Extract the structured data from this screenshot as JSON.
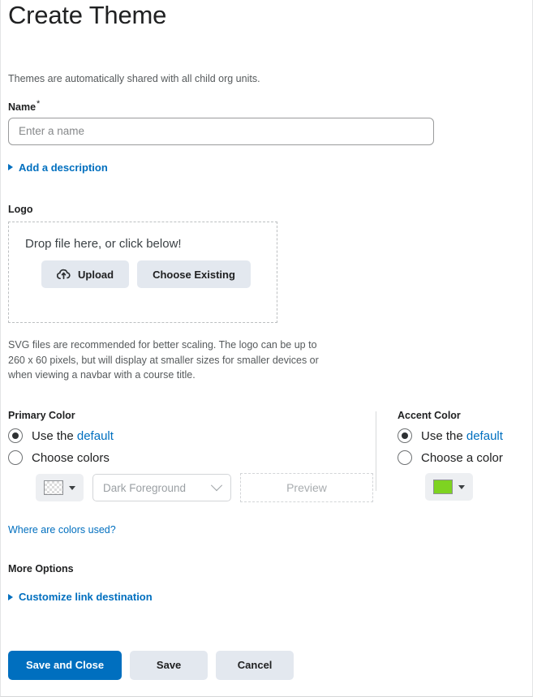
{
  "page": {
    "title": "Create Theme",
    "intro": "Themes are automatically shared with all child org units."
  },
  "name_field": {
    "label": "Name",
    "required_marker": "*",
    "value": "",
    "placeholder": "Enter a name"
  },
  "description": {
    "toggle_label": "Add a description",
    "icon": "triangle-right-icon"
  },
  "logo": {
    "label": "Logo",
    "dropzone_text": "Drop file here, or click below!",
    "upload_label": "Upload",
    "upload_icon": "cloud-upload-icon",
    "choose_existing_label": "Choose Existing",
    "helper_text": "SVG files are recommended for better scaling. The logo can be up to 260 x 60 pixels, but will display at smaller sizes for smaller devices or when viewing a navbar with a course title."
  },
  "primary_color": {
    "label": "Primary Color",
    "option_default_prefix": "Use the ",
    "option_default_link": "default",
    "option_default_selected": true,
    "option_choose": "Choose colors",
    "option_choose_selected": false,
    "swatch_color": "transparent-checker",
    "swatch_icon": "caret-down-icon",
    "select_value": "Dark Foreground",
    "select_icon": "chevron-down-icon",
    "preview_label": "Preview"
  },
  "accent_color": {
    "label": "Accent Color",
    "option_default_prefix": "Use the ",
    "option_default_link": "default",
    "option_default_selected": true,
    "option_choose": "Choose a color",
    "option_choose_selected": false,
    "swatch_color": "#7ED321",
    "swatch_icon": "caret-down-icon"
  },
  "links": {
    "where_are_colors_used": "Where are colors used?"
  },
  "more_options": {
    "label": "More Options",
    "customize_link_destination": "Customize link destination",
    "icon": "triangle-right-icon"
  },
  "footer": {
    "save_and_close": "Save and Close",
    "save": "Save",
    "cancel": "Cancel"
  },
  "colors": {
    "accent_blue": "#006FBF",
    "green_swatch": "#7ED321",
    "button_grey": "#E3E8EF"
  }
}
